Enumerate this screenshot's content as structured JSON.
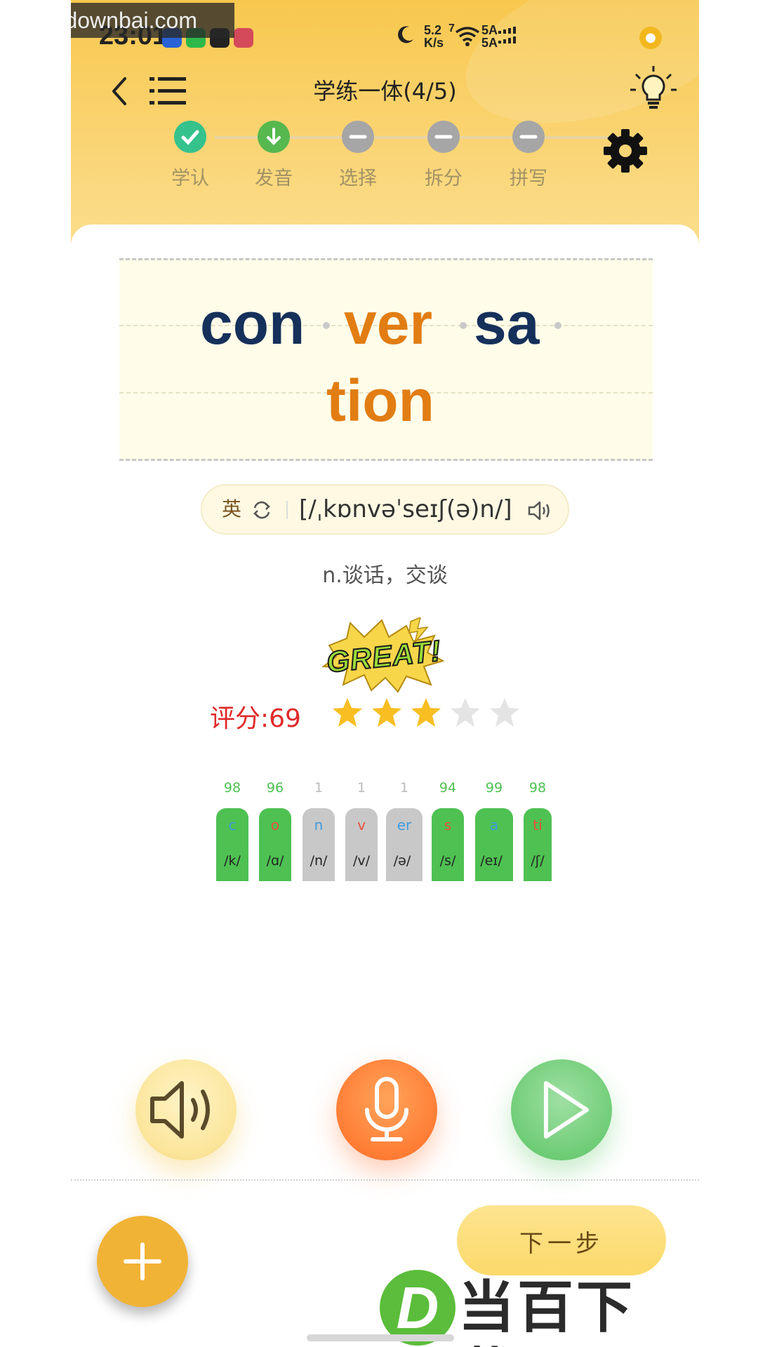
{
  "watermark": "www.downbai.com",
  "status": {
    "time": "23:01",
    "speed_top": "5.2",
    "speed_bottom": "K/s",
    "signal_a": "5A",
    "signal_b": "5A",
    "wifi_badge": "7"
  },
  "nav": {
    "title": "学练一体(4/5)",
    "back_icon": "chevron-left-icon",
    "menu_icon": "list-icon",
    "hint_icon": "lightbulb-icon"
  },
  "steps": [
    {
      "label": "学认",
      "state": "done"
    },
    {
      "label": "发音",
      "state": "current"
    },
    {
      "label": "选择",
      "state": "locked"
    },
    {
      "label": "拆分",
      "state": "locked"
    },
    {
      "label": "拼写",
      "state": "locked"
    }
  ],
  "word": {
    "syllables": [
      {
        "text": "con",
        "color": "#15305a"
      },
      {
        "text": "ver",
        "color": "#e17d13"
      },
      {
        "text": "sa",
        "color": "#15305a"
      },
      {
        "text": "tion",
        "color": "#e17d13"
      }
    ]
  },
  "pronunciation": {
    "lang": "英",
    "ipa": "[/ˌkɒnvəˈseɪʃ(ə)n/]"
  },
  "meaning": "n.谈话，交谈",
  "result": {
    "badge": "GREAT!",
    "score_label": "评分:69",
    "stars_filled": 3,
    "stars_total": 5
  },
  "phonemes": [
    {
      "score": "98",
      "letter": "c",
      "ipa": "/k/",
      "ok": true,
      "letter_color": "#3f9be0"
    },
    {
      "score": "96",
      "letter": "o",
      "ipa": "/ɑ/",
      "ok": true,
      "letter_color": "#e8513c"
    },
    {
      "score": "1",
      "letter": "n",
      "ipa": "/n/",
      "ok": false,
      "letter_color": "#3f9be0"
    },
    {
      "score": "1",
      "letter": "v",
      "ipa": "/v/",
      "ok": false,
      "letter_color": "#e8513c"
    },
    {
      "score": "1",
      "letter": "er",
      "ipa": "/ə/",
      "ok": false,
      "letter_color": "#3f9be0"
    },
    {
      "score": "94",
      "letter": "s",
      "ipa": "/s/",
      "ok": true,
      "letter_color": "#e8513c"
    },
    {
      "score": "99",
      "letter": "a",
      "ipa": "/eɪ/",
      "ok": true,
      "letter_color": "#3f9be0"
    },
    {
      "score": "98",
      "letter": "ti",
      "ipa": "/ʃ/",
      "ok": true,
      "letter_color": "#e8513c"
    }
  ],
  "controls": {
    "sound_icon": "speaker-icon",
    "record_icon": "microphone-icon",
    "play_icon": "play-icon"
  },
  "footer": {
    "next_label": "下一步",
    "add_icon": "plus-icon"
  },
  "overlay_logo": {
    "letter": "D",
    "text": "当百下载"
  },
  "colors": {
    "header": "#f8c84e",
    "score": "#e02929",
    "good": "#4ec152",
    "bad": "#c8c8c8"
  }
}
